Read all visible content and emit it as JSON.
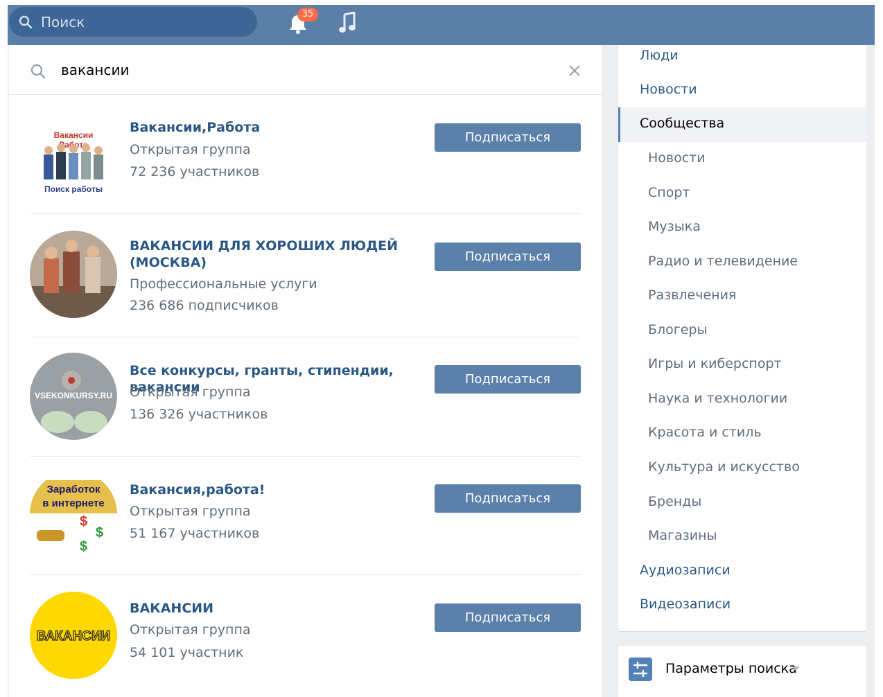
{
  "header": {
    "search_placeholder": "Поиск",
    "notifications_count": "35"
  },
  "query": {
    "text": "вакансии"
  },
  "results": [
    {
      "title": "Вакансии,Работа",
      "type": "Открытая группа",
      "members": "72 236 участников",
      "button": "Подписаться",
      "avatar_text_top": "Вакансии",
      "avatar_text_mid": "Работа",
      "avatar_text_bottom": "Поиск работы"
    },
    {
      "title": "ВАКАНСИИ ДЛЯ ХОРОШИХ ЛЮДЕЙ (МОСКВА)",
      "type": "Профессиональные услуги",
      "members": "236 686 подписчиков",
      "button": "Подписаться"
    },
    {
      "title": "Все конкурсы, гранты, стипендии, вакансии",
      "type": "Открытая группа",
      "members": "136 326 участников",
      "button": "Подписаться",
      "avatar_text": "VSEKONKURSY.RU"
    },
    {
      "title": "Вакансия,работа!",
      "type": "Открытая группа",
      "members": "51 167 участников",
      "button": "Подписаться",
      "avatar_text_top": "Заработок",
      "avatar_text_bottom": "в интернете"
    },
    {
      "title": "ВАКАНСИИ",
      "type": "Открытая группа",
      "members": "54 101 участник",
      "button": "Подписаться",
      "avatar_text": "ВАКАНСИИ"
    }
  ],
  "menu": {
    "items": [
      {
        "label": "Люди"
      },
      {
        "label": "Новости"
      },
      {
        "label": "Сообщества"
      },
      {
        "label": "Новости"
      },
      {
        "label": "Спорт"
      },
      {
        "label": "Музыка"
      },
      {
        "label": "Радио и телевидение"
      },
      {
        "label": "Развлечения"
      },
      {
        "label": "Блогеры"
      },
      {
        "label": "Игры и киберспорт"
      },
      {
        "label": "Наука и технологии"
      },
      {
        "label": "Красота и стиль"
      },
      {
        "label": "Культура и искусство"
      },
      {
        "label": "Бренды"
      },
      {
        "label": "Магазины"
      },
      {
        "label": "Аудиозаписи"
      },
      {
        "label": "Видеозаписи"
      }
    ],
    "params_label": "Параметры поиска"
  },
  "colors": {
    "header": "#5b7fa6",
    "link": "#2a5885",
    "button": "#5b80aa",
    "badge": "#ff6b46"
  }
}
